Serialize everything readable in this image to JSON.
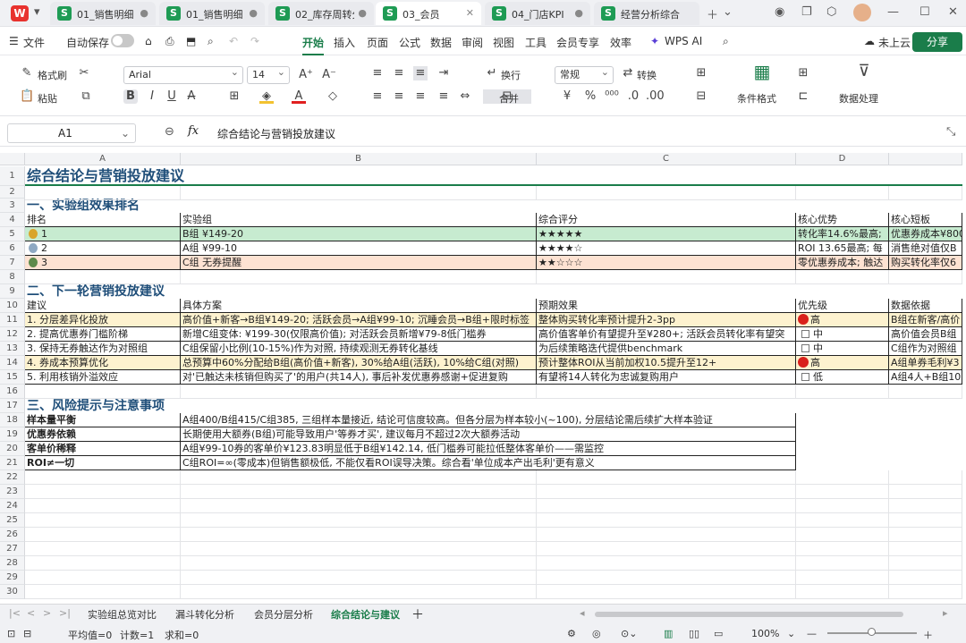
{
  "tabs": [
    {
      "label": "01_销售明细",
      "active": false
    },
    {
      "label": "01_销售明细",
      "active": false
    },
    {
      "label": "02_库存周转分析",
      "active": false
    },
    {
      "label": "03_会员",
      "active": true
    },
    {
      "label": "04_门店KPI",
      "active": false
    },
    {
      "label": "经营分析综合报",
      "active": false
    }
  ],
  "menu": {
    "file": "文件",
    "autosave": "自动保存",
    "items": [
      "开始",
      "插入",
      "页面",
      "公式",
      "数据",
      "审阅",
      "视图",
      "工具",
      "会员专享",
      "效率"
    ],
    "wpsai": "WPS AI",
    "cloud": "未上云",
    "share": "分享"
  },
  "ribbon": {
    "format_painter": "格式刷",
    "paste": "粘贴",
    "font": "Arial",
    "font_size": "14",
    "wrap": "换行",
    "merge": "合并",
    "number_format": "常规",
    "convert": "转换",
    "cond_format": "条件格式",
    "data_process": "数据处理"
  },
  "formula": {
    "cell_ref": "A1",
    "fx": "fx",
    "content": "综合结论与营销投放建议"
  },
  "columns": [
    "A",
    "B",
    "C",
    "D"
  ],
  "rows": [
    "1",
    "2",
    "3",
    "4",
    "5",
    "6",
    "7",
    "8",
    "9",
    "10",
    "11",
    "12",
    "13",
    "14",
    "15",
    "16",
    "17",
    "18",
    "19",
    "20",
    "21",
    "22",
    "23",
    "24",
    "25",
    "26",
    "27",
    "28",
    "29",
    "30"
  ],
  "sheet": {
    "title": "综合结论与营销投放建议",
    "sec1": "一、实验组效果排名",
    "rank_headers": [
      "排名",
      "实验组",
      "综合评分",
      "核心优势",
      "核心短板"
    ],
    "rank_rows": [
      {
        "rank": "1",
        "group": "B组 ¥149-20",
        "score": "★★★★★",
        "adv": "转化率14.6%最高;",
        "weak": "优惠券成本¥800",
        "bg": "#c7ebd0",
        "medal": "#d9a52b"
      },
      {
        "rank": "2",
        "group": "A组 ¥99-10",
        "score": "★★★★☆",
        "adv": "ROI 13.65最高; 每",
        "weak": "消售绝对值仅B",
        "bg": "#ffffff",
        "medal": "#8fa9c3"
      },
      {
        "rank": "3",
        "group": "C组 无券提醒",
        "score": "★★☆☆☆",
        "adv": "零优惠券成本; 触达",
        "weak": "购买转化率仅6",
        "bg": "#fde2d2",
        "medal": "#5d8a4b"
      }
    ],
    "sec2": "二、下一轮营销投放建议",
    "sugg_headers": [
      "建议",
      "具体方案",
      "预期效果",
      "优先级",
      "数据依据"
    ],
    "sugg_rows": [
      {
        "s": "1. 分层差异化投放",
        "plan": "高价值+新客→B组¥149-20; 活跃会员→A组¥99-10; 沉睡会员→B组+限时标签",
        "effect": "整体购买转化率预计提升2-3pp",
        "pri": "高",
        "basis": "B组在新客/高价",
        "bg": "#fdf2cf",
        "dot": true
      },
      {
        "s": "2. 提高优惠券门槛阶梯",
        "plan": "新增C组变体: ¥199-30(仅限高价值); 对活跃会员新增¥79-8低门槛券",
        "effect": "高价值客单价有望提升至¥280+; 活跃会员转化率有望突",
        "pri": "中",
        "basis": "高价值会员B组",
        "bg": "#ffffff",
        "dot": false
      },
      {
        "s": "3. 保持无券触达作为对照组",
        "plan": "C组保留小比例(10-15%)作为对照, 持续观测无券转化基线",
        "effect": "为后续策略迭代提供benchmark",
        "pri": "中",
        "basis": "C组作为对照组",
        "bg": "#ffffff",
        "dot": false
      },
      {
        "s": "4. 券成本预算优化",
        "plan": "总预算中60%分配给B组(高价值+新客), 30%给A组(活跃), 10%给C组(对照)",
        "effect": "预计整体ROI从当前加权10.5提升至12+",
        "pri": "高",
        "basis": "A组单券毛利¥3",
        "bg": "#fdf2cf",
        "dot": true
      },
      {
        "s": "5. 利用核销外溢效应",
        "plan": "对'已触达未核销但购买了'的用户(共14人), 事后补发优惠券感谢+促进复购",
        "effect": "有望将14人转化为忠诚复购用户",
        "pri": "低",
        "basis": "A组4人+B组10",
        "bg": "#ffffff",
        "dot": false
      }
    ],
    "sec3": "三、风险提示与注意事项",
    "risk_rows": [
      {
        "label": "样本量平衡",
        "text": "A组400/B组415/C组385, 三组样本量接近, 结论可信度较高。但各分层为样本较小(~100), 分层结论需后续扩大样本验证"
      },
      {
        "label": "优惠券依赖",
        "text": "长期使用大额券(B组)可能导致用户'等券才买', 建议每月不超过2次大额券活动"
      },
      {
        "label": "客单价稀释",
        "text": "A组¥99-10券的客单价¥123.83明显低于B组¥142.14, 低门槛券可能拉低整体客单价——需监控"
      },
      {
        "label": "ROI≠一切",
        "text": "C组ROI=∞(零成本)但销售额极低, 不能仅看ROI误导决策。综合看'单位成本产出毛利'更有意义"
      }
    ]
  },
  "sheet_tabs": [
    "实验组总览对比",
    "漏斗转化分析",
    "会员分层分析",
    "综合结论与建议"
  ],
  "status": {
    "avg": "平均值=0",
    "count": "计数=1",
    "sum": "求和=0",
    "zoom": "100%"
  }
}
